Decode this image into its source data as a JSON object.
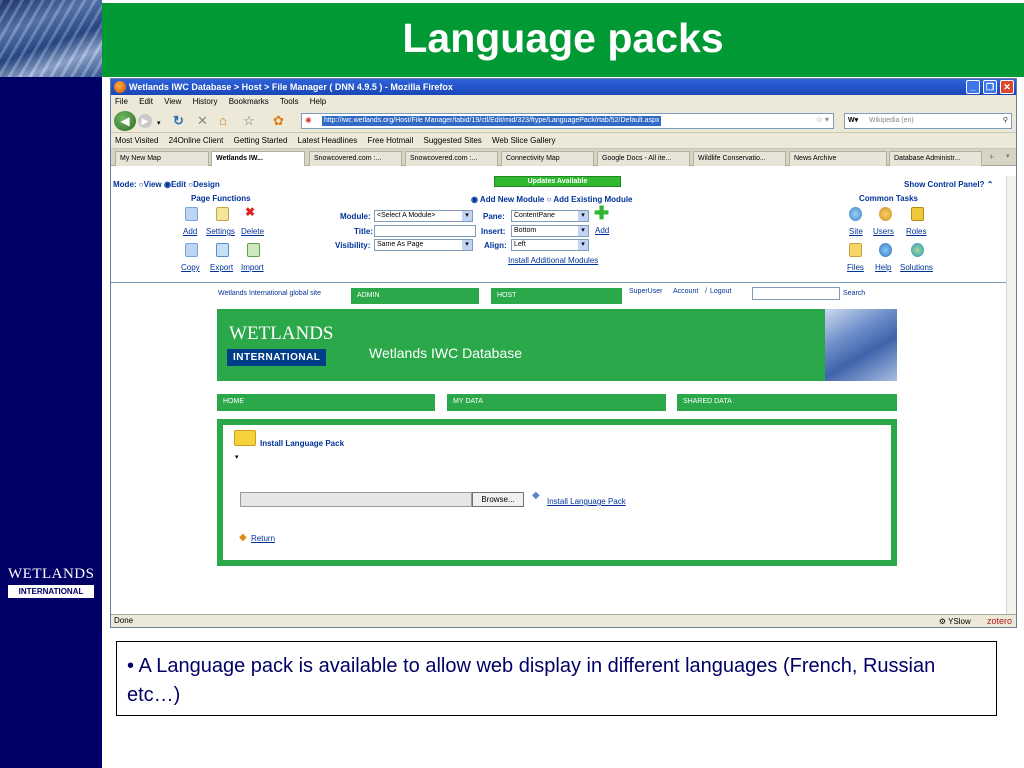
{
  "slide": {
    "title": "Language packs",
    "logo_line1": "WETLANDS",
    "logo_line2": "INTERNATIONAL",
    "caption": "• A Language pack is available to allow web display in different languages (French, Russian etc…)"
  },
  "window": {
    "title": "Wetlands IWC Database > Host > File Manager ( DNN 4.9.5 ) - Mozilla Firefox"
  },
  "menu": [
    "File",
    "Edit",
    "View",
    "History",
    "Bookmarks",
    "Tools",
    "Help"
  ],
  "address": {
    "url": "http://iwc.wetlands.org/Host/File Manager/tabid/19/ctl/Edit/mid/323/ftype/LanguagePack/rtab/52/Default.aspx",
    "search_placeholder": "Wikipedia (en)"
  },
  "bookmarks": [
    "Most Visited",
    "24Online Client",
    "Getting Started",
    "Latest Headlines",
    "Free Hotmail",
    "Suggested Sites",
    "Web Slice Gallery"
  ],
  "tabs": [
    "My New Map",
    "Wetlands IW...",
    "Snowcovered.com :...",
    "Snowcovered.com :...",
    "Connectivity Map",
    "Google Docs - All ite...",
    "Wildlife Conservatio...",
    "News Archive",
    "Database Administr..."
  ],
  "control_panel": {
    "mode_label": "Mode:",
    "mode_view": "View",
    "mode_edit": "Edit",
    "mode_design": "Design",
    "updates": "Updates Available",
    "show_cp": "Show Control Panel?",
    "page_functions": "Page Functions",
    "add": "Add",
    "settings": "Settings",
    "delete": "Delete",
    "copy": "Copy",
    "export": "Export",
    "import": "Import",
    "add_new_module": "Add New Module",
    "add_existing_module": "Add Existing Module",
    "module_label": "Module:",
    "module_value": "<Select A Module>",
    "title_label": "Title:",
    "visibility_label": "Visibility:",
    "visibility_value": "Same As Page",
    "pane_label": "Pane:",
    "pane_value": "ContentPane",
    "insert_label": "Insert:",
    "insert_value": "Bottom",
    "align_label": "Align:",
    "align_value": "Left",
    "add_link": "Add",
    "install_modules": "Install Additional Modules",
    "common_tasks": "Common Tasks",
    "site": "Site",
    "users": "Users",
    "roles": "Roles",
    "files": "Files",
    "help": "Help",
    "solutions": "Solutions"
  },
  "site": {
    "global_link": "Wetlands International global site",
    "admin": "ADMIN",
    "host": "HOST",
    "superuser": "SuperUser",
    "account": "Account",
    "logout": "Logout",
    "search": "Search",
    "logo_line1": "WETLANDS",
    "logo_line2": "INTERNATIONAL",
    "banner_title": "Wetlands IWC Database",
    "nav_home": "HOME",
    "nav_mydata": "MY DATA",
    "nav_shared": "SHARED DATA",
    "module_title": "Install Language Pack",
    "browse": "Browse...",
    "install_link": "Install Language Pack",
    "return": "Return"
  },
  "status": {
    "text": "Done",
    "yslow": "YSlow",
    "zotero": "zotero"
  }
}
